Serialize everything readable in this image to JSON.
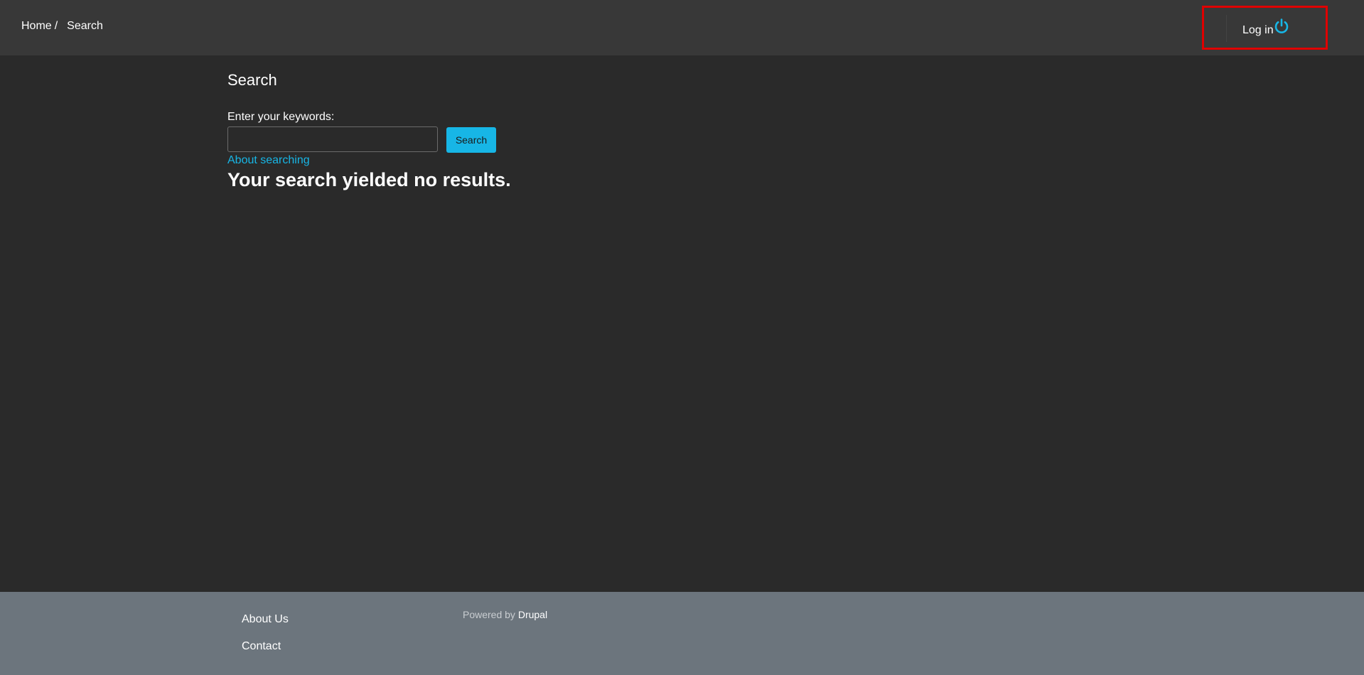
{
  "header": {
    "breadcrumb": {
      "home": "Home",
      "separator": "/",
      "current": "Search"
    },
    "login": {
      "label": "Log in",
      "icon": "power-icon"
    }
  },
  "main": {
    "title": "Search",
    "form": {
      "keywords_label": "Enter your keywords:",
      "keywords_value": "",
      "button_label": "Search"
    },
    "about_link": "About searching",
    "no_results": "Your search yielded no results."
  },
  "footer": {
    "links": [
      "About Us",
      "Contact"
    ],
    "powered_prefix": "Powered by",
    "powered_link": "Drupal"
  },
  "colors": {
    "accent": "#17b6e6",
    "header_bg": "#383838",
    "body_bg": "#2a2a2a",
    "footer_bg": "#6c757d",
    "highlight_border": "#e00000"
  }
}
